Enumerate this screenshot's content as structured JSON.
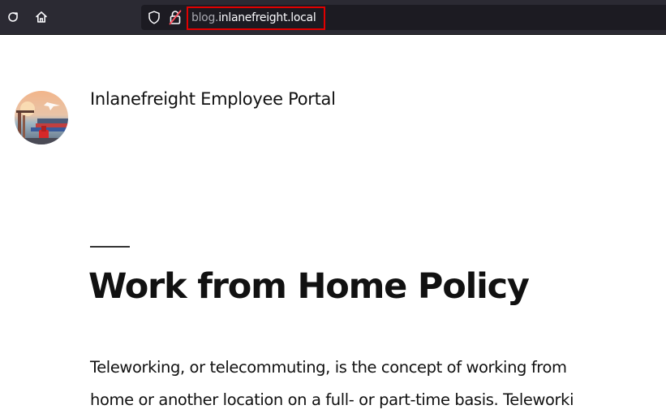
{
  "browser": {
    "url_subdomain": "blog.",
    "url_domain": "inlanefreight.local",
    "colors": {
      "toolbar": "#2b2a33",
      "urlbar": "#1c1b22",
      "highlight": "#e00000"
    },
    "icons": [
      "reload-icon",
      "home-icon",
      "shield-icon",
      "insecure-lock-icon"
    ]
  },
  "site": {
    "title": "Inlanefreight Employee Portal",
    "logo": "site-logo"
  },
  "post": {
    "title": "Work from Home Policy",
    "body_lines": [
      "Teleworking, or telecommuting, is the concept of working from",
      "home or another location on a full- or part-time basis. Teleworki"
    ]
  }
}
